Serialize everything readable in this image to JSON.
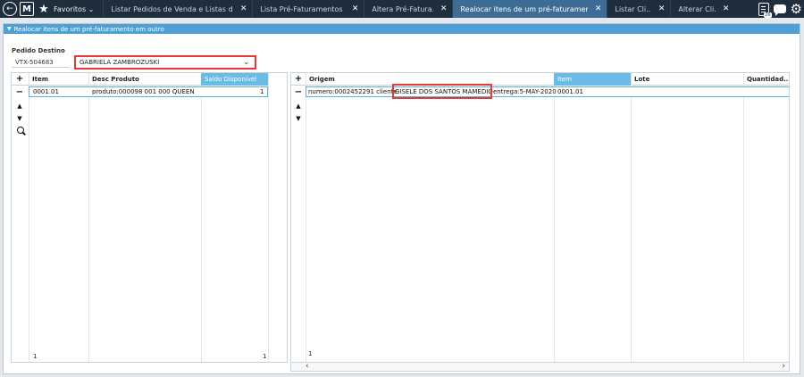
{
  "topbar": {
    "favorites_label": "Favoritos",
    "favorites_caret": "⌄",
    "tabs": [
      {
        "label": "Listar Pedidos de Venda e Listas de C...",
        "close": "✕",
        "active": false
      },
      {
        "label": "Lista Pré-Faturamentos d...",
        "close": "✕",
        "active": false
      },
      {
        "label": "Altera Pré-Fatura...",
        "close": "✕",
        "active": false
      },
      {
        "label": "Realocar itens de um pré-faturamento...",
        "close": "✕",
        "active": true
      },
      {
        "label": "Listar Cli...",
        "close": "✕",
        "active": false
      },
      {
        "label": "Alterar Cli...",
        "close": "✕",
        "active": false
      }
    ],
    "clipboard_badge": "26"
  },
  "panel": {
    "title": "Realocar itens de um pré-faturamento em outro",
    "destination_label": "Pedido Destino",
    "destination_code": "VTX-504683",
    "destination_customer": "GABRIELA  ZAMBROZUSKI"
  },
  "left_grid": {
    "headers": [
      "Item",
      "Desc Produto",
      "Saldo Disponível"
    ],
    "rows": [
      {
        "item": "0001.01",
        "desc": "produto:000098 001 000 QUEEN",
        "saldo": "1"
      }
    ],
    "footer_count": "1",
    "footer_total": "1"
  },
  "right_grid": {
    "headers": [
      "Origem",
      "Item",
      "Lote",
      "Quantidad..."
    ],
    "rows": [
      {
        "origem_prefix": "numero:0002452291 cliente:",
        "origem_client": "GISELE DOS SANTOS MAMEDIO",
        "origem_suffix": "entrega:5-MAY-2020",
        "item": "0001.01",
        "lote": "",
        "quantidade": ""
      }
    ],
    "footer_count": "1"
  },
  "icons": {
    "add": "+",
    "remove": "−",
    "move_up": "▲",
    "move_down": "▼",
    "scroll_left": "‹",
    "scroll_right": "›",
    "select_arrow": "⌄",
    "caret": "▼"
  },
  "colors": {
    "topbar_bg": "#1f2e3d",
    "active_tab": "#3d6d96",
    "panel_header": "#4d9fd6",
    "highlight_header": "#6bbbe8",
    "annotation_red": "#e53935"
  }
}
